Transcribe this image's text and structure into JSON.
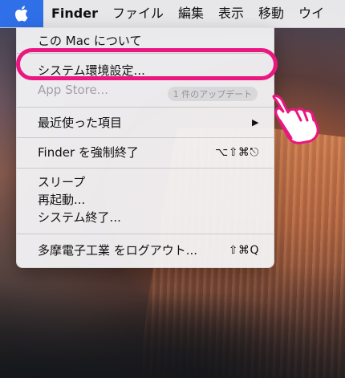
{
  "menubar": {
    "apple_icon": "apple-icon",
    "app_name": "Finder",
    "items": [
      "ファイル",
      "編集",
      "表示",
      "移動",
      "ウイ"
    ]
  },
  "apple_menu": {
    "about": "この Mac について",
    "system_prefs": "システム環境設定...",
    "app_store": "App Store...",
    "app_store_badge": "1 件のアップデート",
    "recent_items": "最近使った項目",
    "recent_items_arrow": "▶",
    "force_quit": "Finder を強制終了",
    "force_quit_shortcut": "⌥⇧⌘⎋",
    "sleep": "スリープ",
    "restart": "再起動...",
    "shutdown": "システム終了...",
    "logout": "多摩電子工業 をログアウト...",
    "logout_shortcut": "⇧⌘Q"
  },
  "colors": {
    "highlight": "#e9177f",
    "apple_menu_active": "#2f6fe8"
  },
  "annotation_icon": "pointing-hand-icon"
}
